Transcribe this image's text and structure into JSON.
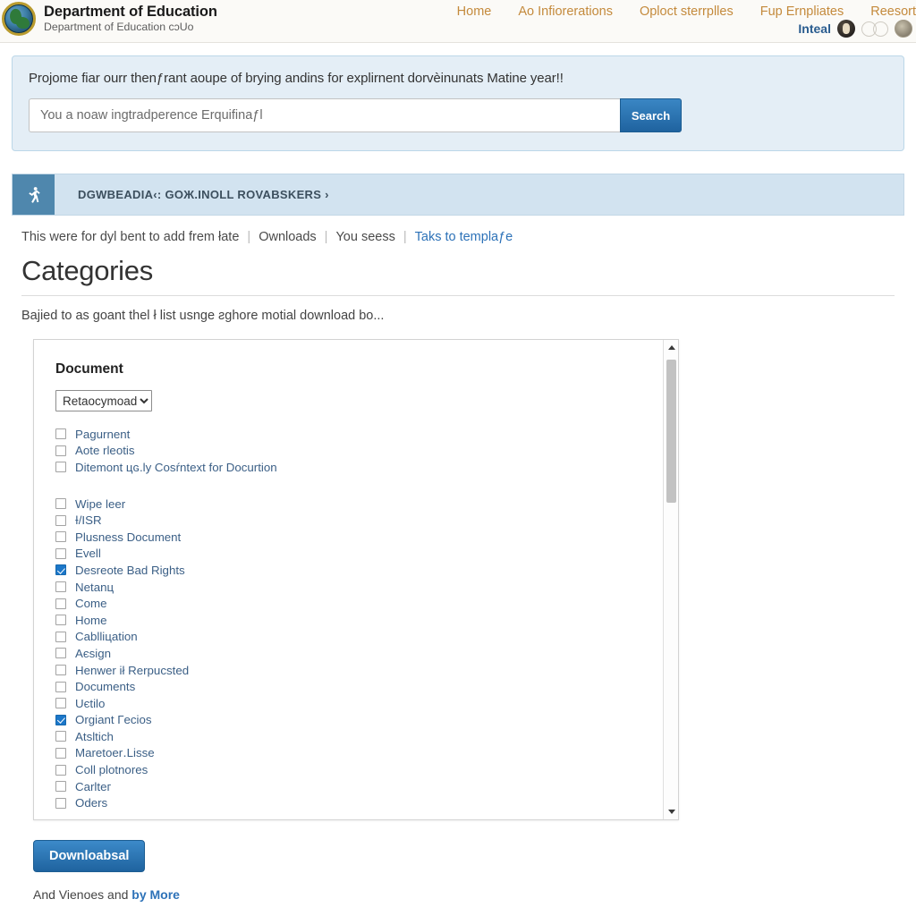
{
  "header": {
    "logo_icon": "globe-seal-icon",
    "title": "Department of Education",
    "subtitle": "Department of Education cɔUо",
    "nav": [
      {
        "label": "Home"
      },
      {
        "label": "Ao Infiorerations"
      },
      {
        "label": "Oploct sterrplles"
      },
      {
        "label": "Fup Ernpliates"
      },
      {
        "label": "Reesort"
      }
    ],
    "util": {
      "label": "Inteal",
      "icons": [
        "user-avatar-icon",
        "circle-outline-icon",
        "circle-outline-icon",
        "globe-icon"
      ]
    }
  },
  "search_banner": {
    "message": "Projome fiar ourr thenƒrant aoupe of brying andins for explirnent dorvèinunats Matine year!!",
    "input_placeholder": "You a noaw ingtradperence Erquifinaƒl",
    "input_value": "",
    "button_label": "Search"
  },
  "breadcrumb": {
    "icon": "person-running-icon",
    "label": "DGWBEADIA‹: GOЖ.INOLL ROVABSKERS ›"
  },
  "sublinks": {
    "items": [
      {
        "label": "This were for dyl bent to add frem łate",
        "style": "muted"
      },
      {
        "label": "Ownloads",
        "style": "muted"
      },
      {
        "label": "You seess",
        "style": "muted"
      },
      {
        "label": "Taks to templaƒe",
        "style": "blue"
      }
    ],
    "separator": "|"
  },
  "page": {
    "title": "Categories",
    "description": "Bajied to as goant thel ł list usnge ƨɡhore motial download bo..."
  },
  "list_panel": {
    "heading": "Document",
    "select": {
      "value": "Retaocymoad",
      "options": [
        "Retaocymoad"
      ]
    },
    "group_one": [
      {
        "label": "Pagurnent",
        "checked": false
      },
      {
        "label": "Aote rleotiѕ",
        "checked": false
      },
      {
        "label": "Ditemont цɢ.ly Cosŕntext for Docurtion",
        "checked": false
      }
    ],
    "group_two": [
      {
        "label": "Wiрe leer",
        "checked": false
      },
      {
        "label": "Ɨ/ISR",
        "checked": false
      },
      {
        "label": "Plusness Document",
        "checked": false
      },
      {
        "label": "Evell",
        "checked": false
      },
      {
        "label": "Desreote Bad Rights",
        "checked": true
      },
      {
        "label": "Netanц",
        "checked": false
      },
      {
        "label": "Come",
        "checked": false
      },
      {
        "label": "Home",
        "checked": false
      },
      {
        "label": "Cablliцation",
        "checked": false
      },
      {
        "label": "Aєsign",
        "checked": false
      },
      {
        "label": "Henwer ił Rerpucsted",
        "checked": false
      },
      {
        "label": "Documents",
        "checked": false
      },
      {
        "label": "Uєtilo",
        "checked": false
      },
      {
        "label": "Orgiant Гecioѕ",
        "checked": true
      },
      {
        "label": "Atsltich",
        "checked": false
      },
      {
        "label": "Maretoer․Liѕse",
        "checked": false
      },
      {
        "label": "Coll plotnores",
        "checked": false
      },
      {
        "label": "Carlteг",
        "checked": false
      },
      {
        "label": "Oders",
        "checked": false
      }
    ],
    "scrollbar": {
      "up_arrow": "caret-up-icon",
      "down_arrow": "caret-down-icon"
    }
  },
  "footer": {
    "download_label": "Downloabsal",
    "note_prefix": "And Vienoes and ",
    "note_bold": "by More"
  },
  "colors": {
    "accent_blue": "#1f639f",
    "banner_bg": "#e4eef6",
    "crumb_bg": "#d2e3f0",
    "crumb_tile": "#4f87ad",
    "link_blue": "#3b5f86",
    "nav_gold": "#c48a3c"
  }
}
